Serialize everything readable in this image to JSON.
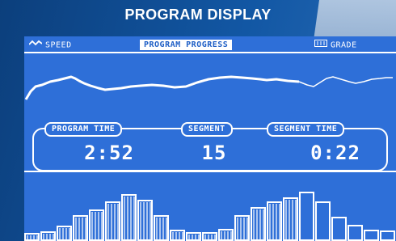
{
  "title": "PROGRAM DISPLAY",
  "tabs": [
    {
      "label": "SPEED",
      "icon": "speed-wave-icon"
    },
    {
      "label": "PROGRAM PROGRESS",
      "active": true
    },
    {
      "label": "GRADE",
      "icon": "grade-bars-icon"
    }
  ],
  "metrics": {
    "program_time": {
      "label": "PROGRAM TIME",
      "value": "2:52"
    },
    "segment": {
      "label": "SEGMENT",
      "value": "15"
    },
    "segment_time": {
      "label": "SEGMENT TIME",
      "value": "0:22"
    }
  },
  "colors": {
    "screen": "#2e6fd8",
    "foreground": "#ffffff",
    "background": "#14529b"
  }
}
